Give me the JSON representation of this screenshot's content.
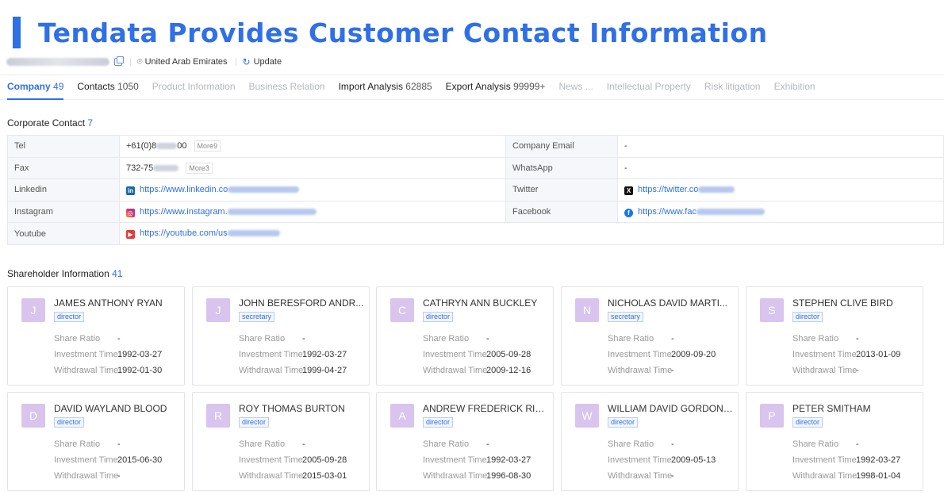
{
  "banner": {
    "title": "Tendata Provides Customer Contact Information"
  },
  "subbar": {
    "location": "United Arab Emirates",
    "update_label": "Update"
  },
  "tabs": [
    {
      "label": "Company",
      "count": "49",
      "style": "active"
    },
    {
      "label": "Contacts",
      "count": "1050",
      "style": "dark"
    },
    {
      "label": "Product Information",
      "count": "",
      "style": "dim"
    },
    {
      "label": "Business Relation",
      "count": "",
      "style": "dim"
    },
    {
      "label": "Import Analysis",
      "count": "62885",
      "style": "dark"
    },
    {
      "label": "Export Analysis",
      "count": "99999+",
      "style": "dark"
    },
    {
      "label": "News ...",
      "count": "",
      "style": "dim"
    },
    {
      "label": "Intellectual Property",
      "count": "",
      "style": "dim"
    },
    {
      "label": "Risk litigation",
      "count": "",
      "style": "dim"
    },
    {
      "label": "Exhibition",
      "count": "",
      "style": "dim"
    }
  ],
  "corporate_contact": {
    "title": "Corporate Contact",
    "count": "7",
    "tel": {
      "label": "Tel",
      "value_start": "+61(0)8",
      "value_end": "00",
      "more": "More",
      "more_count": "9"
    },
    "fax": {
      "label": "Fax",
      "value_start": "732-75",
      "more": "More",
      "more_count": "3"
    },
    "company_email": {
      "label": "Company Email",
      "value": "-"
    },
    "whatsapp": {
      "label": "WhatsApp",
      "value": "-"
    },
    "linkedin": {
      "label": "Linkedin",
      "value": "https://www.linkedin.co"
    },
    "twitter": {
      "label": "Twitter",
      "value": "https://twitter.co"
    },
    "instagram": {
      "label": "Instagram",
      "value": "https://www.instagram."
    },
    "facebook": {
      "label": "Facebook",
      "value": "https://www.fac"
    },
    "youtube": {
      "label": "Youtube",
      "value": "https://youtube.com/us"
    }
  },
  "shareholders": {
    "title": "Shareholder Information",
    "count": "41",
    "labels": {
      "share_ratio": "Share Ratio",
      "investment_time": "Investment Time",
      "withdrawal_time": "Withdrawal Time"
    },
    "items": [
      {
        "initial": "J",
        "name": "JAMES ANTHONY RYAN",
        "role": "director",
        "share_ratio": "-",
        "investment_time": "1992-03-27",
        "withdrawal_time": "1992-01-30"
      },
      {
        "initial": "J",
        "name": "JOHN BERESFORD ANDR...",
        "role": "secretary",
        "share_ratio": "-",
        "investment_time": "1992-03-27",
        "withdrawal_time": "1999-04-27"
      },
      {
        "initial": "C",
        "name": "CATHRYN ANN BUCKLEY",
        "role": "director",
        "share_ratio": "-",
        "investment_time": "2005-09-28",
        "withdrawal_time": "2009-12-16"
      },
      {
        "initial": "N",
        "name": "NICHOLAS DAVID MARTI...",
        "role": "secretary",
        "share_ratio": "-",
        "investment_time": "2009-09-20",
        "withdrawal_time": "-"
      },
      {
        "initial": "S",
        "name": "STEPHEN CLIVE BIRD",
        "role": "director",
        "share_ratio": "-",
        "investment_time": "2013-01-09",
        "withdrawal_time": "-"
      },
      {
        "initial": "D",
        "name": "DAVID WAYLAND BLOOD",
        "role": "director",
        "share_ratio": "-",
        "investment_time": "2015-06-30",
        "withdrawal_time": "-"
      },
      {
        "initial": "R",
        "name": "ROY THOMAS BURTON",
        "role": "director",
        "share_ratio": "-",
        "investment_time": "2005-09-28",
        "withdrawal_time": "2015-03-01"
      },
      {
        "initial": "A",
        "name": "ANDREW FREDERICK RIC...",
        "role": "director",
        "share_ratio": "-",
        "investment_time": "1992-03-27",
        "withdrawal_time": "1996-08-30"
      },
      {
        "initial": "W",
        "name": "WILLIAM DAVID GORDON ...",
        "role": "director",
        "share_ratio": "-",
        "investment_time": "2009-05-13",
        "withdrawal_time": "-"
      },
      {
        "initial": "P",
        "name": "PETER SMITHAM",
        "role": "director",
        "share_ratio": "-",
        "investment_time": "1992-03-27",
        "withdrawal_time": "1998-01-04"
      }
    ]
  },
  "colors": {
    "accent": "#2f6fe8",
    "avatar": "#d9c4ee"
  },
  "icons": {
    "copy": "copy-icon",
    "location": "location-pin-icon",
    "update": "refresh-icon"
  }
}
